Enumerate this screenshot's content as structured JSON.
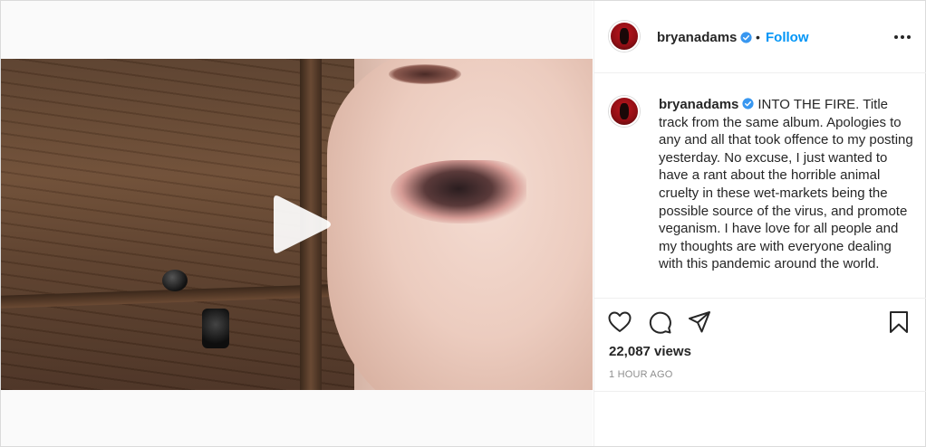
{
  "post": {
    "username": "bryanadams",
    "follow_label": "Follow",
    "separator": "•",
    "caption": "INTO THE FIRE. Title track from the same album. Apologies to any and all that took offence to my posting yesterday. No excuse, I just wanted to have a rant about the horrible animal cruelty in these wet-markets being the possible source of the virus, and promote veganism. I have love for all people and my thoughts are with everyone dealing with this pandemic around the world.",
    "views": "22,087 views",
    "timestamp": "1 HOUR AGO"
  },
  "icons": {
    "verified": "verified-badge-icon",
    "more": "more-options-icon",
    "play": "play-icon",
    "like": "heart-icon",
    "comment": "comment-icon",
    "share": "share-icon",
    "save": "bookmark-icon"
  },
  "colors": {
    "accent": "#0095f6",
    "text": "#262626",
    "muted": "#8e8e8e",
    "border": "#dbdbdb"
  }
}
